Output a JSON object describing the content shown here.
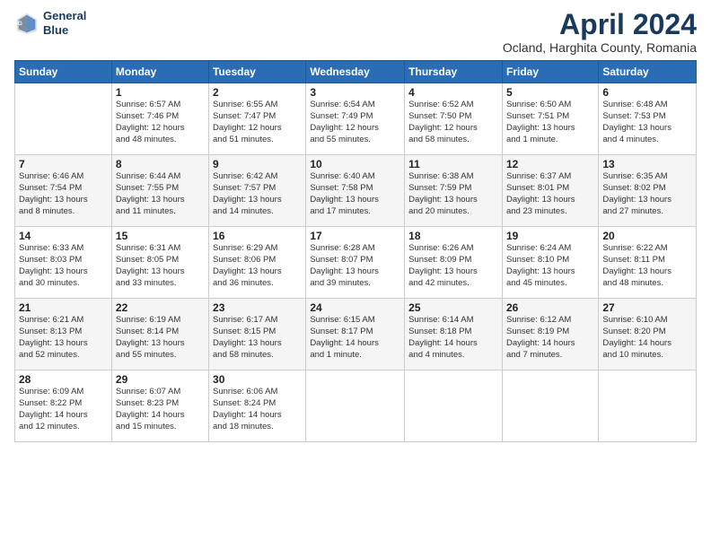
{
  "header": {
    "logo_line1": "General",
    "logo_line2": "Blue",
    "title": "April 2024",
    "subtitle": "Ocland, Harghita County, Romania"
  },
  "days_of_week": [
    "Sunday",
    "Monday",
    "Tuesday",
    "Wednesday",
    "Thursday",
    "Friday",
    "Saturday"
  ],
  "weeks": [
    [
      {
        "day": "",
        "info": ""
      },
      {
        "day": "1",
        "info": "Sunrise: 6:57 AM\nSunset: 7:46 PM\nDaylight: 12 hours\nand 48 minutes."
      },
      {
        "day": "2",
        "info": "Sunrise: 6:55 AM\nSunset: 7:47 PM\nDaylight: 12 hours\nand 51 minutes."
      },
      {
        "day": "3",
        "info": "Sunrise: 6:54 AM\nSunset: 7:49 PM\nDaylight: 12 hours\nand 55 minutes."
      },
      {
        "day": "4",
        "info": "Sunrise: 6:52 AM\nSunset: 7:50 PM\nDaylight: 12 hours\nand 58 minutes."
      },
      {
        "day": "5",
        "info": "Sunrise: 6:50 AM\nSunset: 7:51 PM\nDaylight: 13 hours\nand 1 minute."
      },
      {
        "day": "6",
        "info": "Sunrise: 6:48 AM\nSunset: 7:53 PM\nDaylight: 13 hours\nand 4 minutes."
      }
    ],
    [
      {
        "day": "7",
        "info": "Sunrise: 6:46 AM\nSunset: 7:54 PM\nDaylight: 13 hours\nand 8 minutes."
      },
      {
        "day": "8",
        "info": "Sunrise: 6:44 AM\nSunset: 7:55 PM\nDaylight: 13 hours\nand 11 minutes."
      },
      {
        "day": "9",
        "info": "Sunrise: 6:42 AM\nSunset: 7:57 PM\nDaylight: 13 hours\nand 14 minutes."
      },
      {
        "day": "10",
        "info": "Sunrise: 6:40 AM\nSunset: 7:58 PM\nDaylight: 13 hours\nand 17 minutes."
      },
      {
        "day": "11",
        "info": "Sunrise: 6:38 AM\nSunset: 7:59 PM\nDaylight: 13 hours\nand 20 minutes."
      },
      {
        "day": "12",
        "info": "Sunrise: 6:37 AM\nSunset: 8:01 PM\nDaylight: 13 hours\nand 23 minutes."
      },
      {
        "day": "13",
        "info": "Sunrise: 6:35 AM\nSunset: 8:02 PM\nDaylight: 13 hours\nand 27 minutes."
      }
    ],
    [
      {
        "day": "14",
        "info": "Sunrise: 6:33 AM\nSunset: 8:03 PM\nDaylight: 13 hours\nand 30 minutes."
      },
      {
        "day": "15",
        "info": "Sunrise: 6:31 AM\nSunset: 8:05 PM\nDaylight: 13 hours\nand 33 minutes."
      },
      {
        "day": "16",
        "info": "Sunrise: 6:29 AM\nSunset: 8:06 PM\nDaylight: 13 hours\nand 36 minutes."
      },
      {
        "day": "17",
        "info": "Sunrise: 6:28 AM\nSunset: 8:07 PM\nDaylight: 13 hours\nand 39 minutes."
      },
      {
        "day": "18",
        "info": "Sunrise: 6:26 AM\nSunset: 8:09 PM\nDaylight: 13 hours\nand 42 minutes."
      },
      {
        "day": "19",
        "info": "Sunrise: 6:24 AM\nSunset: 8:10 PM\nDaylight: 13 hours\nand 45 minutes."
      },
      {
        "day": "20",
        "info": "Sunrise: 6:22 AM\nSunset: 8:11 PM\nDaylight: 13 hours\nand 48 minutes."
      }
    ],
    [
      {
        "day": "21",
        "info": "Sunrise: 6:21 AM\nSunset: 8:13 PM\nDaylight: 13 hours\nand 52 minutes."
      },
      {
        "day": "22",
        "info": "Sunrise: 6:19 AM\nSunset: 8:14 PM\nDaylight: 13 hours\nand 55 minutes."
      },
      {
        "day": "23",
        "info": "Sunrise: 6:17 AM\nSunset: 8:15 PM\nDaylight: 13 hours\nand 58 minutes."
      },
      {
        "day": "24",
        "info": "Sunrise: 6:15 AM\nSunset: 8:17 PM\nDaylight: 14 hours\nand 1 minute."
      },
      {
        "day": "25",
        "info": "Sunrise: 6:14 AM\nSunset: 8:18 PM\nDaylight: 14 hours\nand 4 minutes."
      },
      {
        "day": "26",
        "info": "Sunrise: 6:12 AM\nSunset: 8:19 PM\nDaylight: 14 hours\nand 7 minutes."
      },
      {
        "day": "27",
        "info": "Sunrise: 6:10 AM\nSunset: 8:20 PM\nDaylight: 14 hours\nand 10 minutes."
      }
    ],
    [
      {
        "day": "28",
        "info": "Sunrise: 6:09 AM\nSunset: 8:22 PM\nDaylight: 14 hours\nand 12 minutes."
      },
      {
        "day": "29",
        "info": "Sunrise: 6:07 AM\nSunset: 8:23 PM\nDaylight: 14 hours\nand 15 minutes."
      },
      {
        "day": "30",
        "info": "Sunrise: 6:06 AM\nSunset: 8:24 PM\nDaylight: 14 hours\nand 18 minutes."
      },
      {
        "day": "",
        "info": ""
      },
      {
        "day": "",
        "info": ""
      },
      {
        "day": "",
        "info": ""
      },
      {
        "day": "",
        "info": ""
      }
    ]
  ]
}
